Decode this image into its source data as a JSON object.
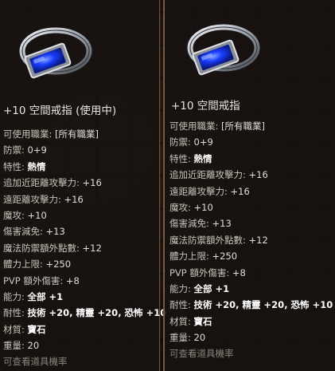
{
  "left": {
    "title": "+10 空間戒指 (使用中)",
    "stats": [
      {
        "label": "可使用職業: ",
        "value": "[所有職業]",
        "style": "plain"
      },
      {
        "label": "防禦: ",
        "value": "0+9",
        "style": "plain"
      },
      {
        "label": "特性: ",
        "value": "熱情",
        "style": "bold"
      },
      {
        "label": "追加近距離攻擊力: ",
        "value": "+16",
        "style": "plain"
      },
      {
        "label": "遠距離攻擊力: ",
        "value": "+16",
        "style": "plain"
      },
      {
        "label": "魔攻: ",
        "value": "+10",
        "style": "plain"
      },
      {
        "label": "傷害減免: ",
        "value": "+13",
        "style": "plain"
      },
      {
        "label": "魔法防禦額外點數: ",
        "value": "+12",
        "style": "plain"
      },
      {
        "label": "體力上限: ",
        "value": "+250",
        "style": "plain"
      },
      {
        "label": "PVP 額外傷害: ",
        "value": "+8",
        "style": "plain"
      },
      {
        "label": "能力: ",
        "value": "全部 +1",
        "style": "bold"
      },
      {
        "label": "耐性: ",
        "value": "技術 +20, 精靈 +20, 恐怖 +10",
        "style": "bold"
      },
      {
        "label": "材質: ",
        "value": "寶石",
        "style": "bold"
      },
      {
        "label": "重量: ",
        "value": "20",
        "style": "plain"
      },
      {
        "label": "可查看道具機率",
        "value": "",
        "style": "muted"
      }
    ]
  },
  "right": {
    "title": "+10 空間戒指",
    "stats": [
      {
        "label": "可使用職業: ",
        "value": "[所有職業]",
        "style": "plain"
      },
      {
        "label": "防禦: ",
        "value": "0+9",
        "style": "plain"
      },
      {
        "label": "特性: ",
        "value": "熱情",
        "style": "bold"
      },
      {
        "label": "追加近距離攻擊力: ",
        "value": "+16",
        "style": "plain"
      },
      {
        "label": "遠距離攻擊力: ",
        "value": "+16",
        "style": "plain"
      },
      {
        "label": "魔攻: ",
        "value": "+10",
        "style": "plain"
      },
      {
        "label": "傷害減免: ",
        "value": "+13",
        "style": "plain"
      },
      {
        "label": "魔法防禦額外點數: ",
        "value": "+12",
        "style": "plain"
      },
      {
        "label": "體力上限: ",
        "value": "+250",
        "style": "plain"
      },
      {
        "label": "PVP 額外傷害: ",
        "value": "+8",
        "style": "plain"
      },
      {
        "label": "能力: ",
        "value": "全部 +1",
        "style": "bold"
      },
      {
        "label": "耐性: ",
        "value": "技術 +20, 精靈 +20, 恐怖 +10",
        "style": "bold"
      },
      {
        "label": "材質: ",
        "value": "寶石",
        "style": "bold"
      },
      {
        "label": "重量: ",
        "value": "20",
        "style": "plain"
      },
      {
        "label": "可查看道具機率",
        "value": "",
        "style": "muted"
      }
    ]
  },
  "colors": {
    "gem": "#1a3cff",
    "band": "#b8bcc4",
    "frame": "#7a5a3c"
  },
  "icons": {
    "item": "sapphire-ring-icon"
  }
}
